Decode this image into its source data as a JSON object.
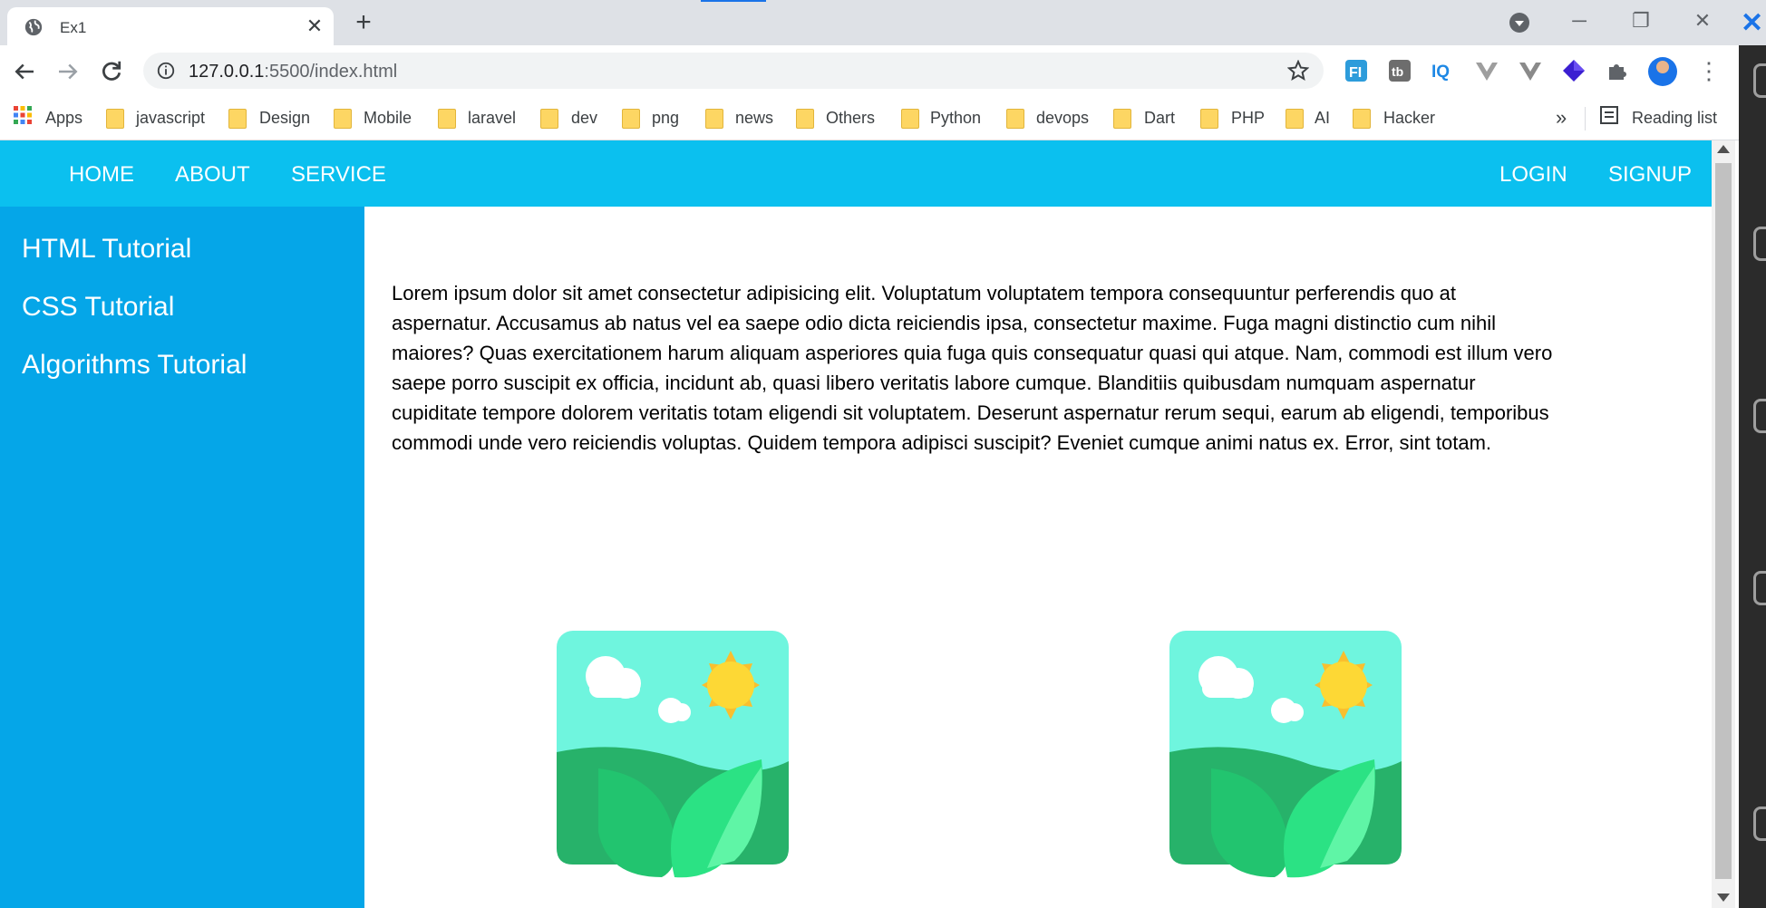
{
  "browser": {
    "tab_title": "Ex1",
    "url_host": "127.0.0.1",
    "url_rest": ":5500/index.html",
    "bookmarks": [
      "Apps",
      "javascript",
      "Design",
      "Mobile",
      "laravel",
      "dev",
      "png",
      "news",
      "Others",
      "Python",
      "devops",
      "Dart",
      "PHP",
      "AI",
      "Hacker"
    ],
    "more_label": "»",
    "reading_list_label": "Reading list",
    "extensions": [
      "fi-extension-icon",
      "tb-extension-icon",
      "iq-extension-icon",
      "vue-extension-icon",
      "vue-devtools-extension-icon",
      "diamond-extension-icon",
      "puzzle-extensions-icon"
    ]
  },
  "site": {
    "nav_left": [
      "HOME",
      "ABOUT",
      "SERVICE"
    ],
    "nav_right": [
      "LOGIN",
      "SIGNUP"
    ],
    "sidebar": [
      "HTML Tutorial",
      "CSS Tutorial",
      "Algorithms Tutorial"
    ],
    "paragraph": "Lorem ipsum dolor sit amet consectetur adipisicing elit. Voluptatum voluptatem tempora consequuntur perferendis quo at aspernatur. Accusamus ab natus vel ea saepe odio dicta reiciendis ipsa, consectetur maxime. Fuga magni distinctio cum nihil maiores? Quas exercitationem harum aliquam asperiores quia fuga quis consequatur quasi qui atque. Nam, commodi est illum vero saepe porro suscipit ex officia, incidunt ab, quasi libero veritatis labore cumque. Blanditiis quibusdam numquam aspernatur cupiditate tempore dolorem veritatis totam eligendi sit voluptatem. Deserunt aspernatur rerum sequi, earum ab eligendi, temporibus commodi unde vero reiciendis voluptas. Quidem tempora adipisci suscipit? Eveniet cumque animi natus ex. Error, sint totam.",
    "images": [
      "landscape-image-icon",
      "landscape-image-icon"
    ]
  },
  "colors": {
    "nav_bg": "#0bc0ef",
    "sidebar_bg": "#05a6e8",
    "tabbar_bg": "#dee1e6"
  }
}
